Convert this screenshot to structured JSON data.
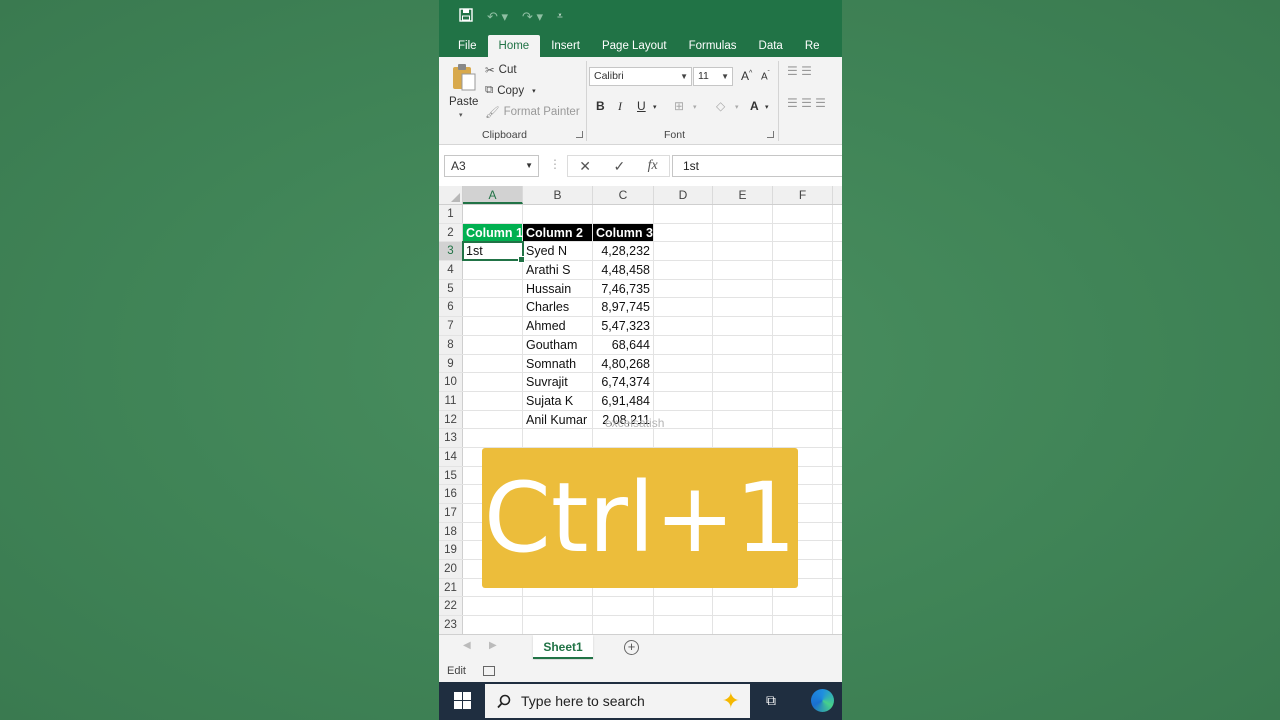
{
  "ribbon_tabs": [
    "File",
    "Home",
    "Insert",
    "Page Layout",
    "Formulas",
    "Data",
    "Re"
  ],
  "active_tab": "Home",
  "clipboard": {
    "paste": "Paste",
    "cut": "Cut",
    "copy": "Copy",
    "format_painter": "Format Painter",
    "group_label": "Clipboard"
  },
  "font": {
    "family": "Calibri",
    "size": "11",
    "bold": "B",
    "italic": "I",
    "underline": "U",
    "grow": "A",
    "shrink": "A",
    "color": "A",
    "group_label": "Font"
  },
  "formula_bar": {
    "name_box": "A3",
    "cancel": "✕",
    "enter": "✓",
    "fx": "fx",
    "content": "1st"
  },
  "columns": [
    "A",
    "B",
    "C",
    "D",
    "E",
    "F"
  ],
  "selected_column": "A",
  "row_numbers": [
    "1",
    "2",
    "3",
    "4",
    "5",
    "6",
    "7",
    "8",
    "9",
    "10",
    "11",
    "12",
    "13",
    "14",
    "15",
    "16",
    "17",
    "18",
    "19",
    "20",
    "21",
    "22",
    "23"
  ],
  "selected_row": "3",
  "table": {
    "headers": [
      "Column 1",
      "Column 2",
      "Column 3"
    ],
    "rows": [
      [
        "1st",
        "Syed N",
        "4,28,232"
      ],
      [
        "",
        "Arathi S",
        "4,48,458"
      ],
      [
        "",
        "Hussain",
        "7,46,735"
      ],
      [
        "",
        "Charles",
        "8,97,745"
      ],
      [
        "",
        "Ahmed",
        "5,47,323"
      ],
      [
        "",
        "Goutham",
        "68,644"
      ],
      [
        "",
        "Somnath",
        "4,80,268"
      ],
      [
        "",
        "Suvrajit",
        "6,74,374"
      ],
      [
        "",
        "Sujata K",
        "6,91,484"
      ],
      [
        "",
        "Anil Kumar",
        "2,08,211"
      ]
    ]
  },
  "watermark": "excelsatish",
  "overlay_text": "Ctrl+1",
  "sheet_tab": "Sheet1",
  "status": "Edit",
  "taskbar": {
    "search_placeholder": "Type here to search"
  },
  "colors": {
    "excel_green": "#217346",
    "header_green_fill": "#00b050",
    "overlay": "#ecbd3b"
  }
}
